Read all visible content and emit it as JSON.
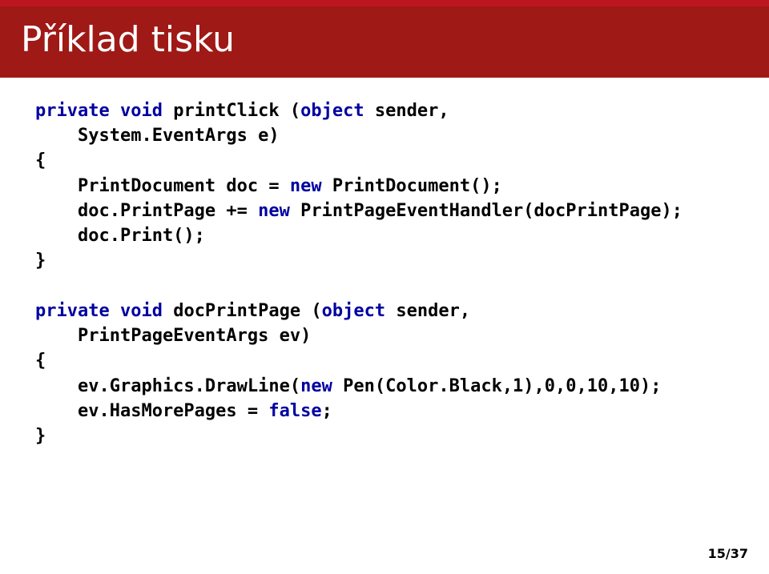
{
  "header": {
    "title": "Příklad tisku"
  },
  "code": {
    "l1a": "private void",
    "l1b": " printClick (",
    "l1c": "object",
    "l1d": " sender,",
    "l2": "    System.EventArgs e)",
    "l3": "{",
    "l4a": "    PrintDocument doc = ",
    "l4b": "new",
    "l4c": " PrintDocument();",
    "l5a": "    doc.PrintPage += ",
    "l5b": "new",
    "l5c": " PrintPageEventHandler(docPrintPage);",
    "l6": "    doc.Print();",
    "l7": "}",
    "l9a": "private void",
    "l9b": " docPrintPage (",
    "l9c": "object",
    "l9d": " sender,",
    "l10": "    PrintPageEventArgs ev)",
    "l11": "{",
    "l12a": "    ev.Graphics.DrawLine(",
    "l12b": "new",
    "l12c": " Pen(Color.Black,1),0,0,10,10);",
    "l13a": "    ev.HasMorePages = ",
    "l13b": "false",
    "l13c": ";",
    "l14": "}"
  },
  "footer": {
    "page": "15/37"
  }
}
